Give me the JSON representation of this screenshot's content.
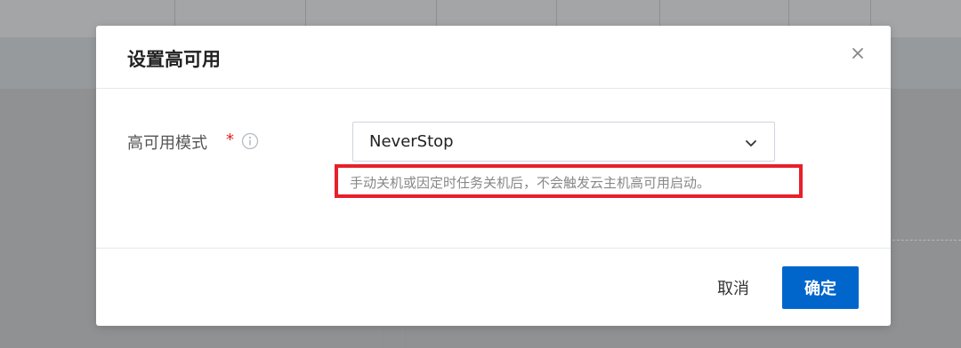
{
  "dialog": {
    "title": "设置高可用",
    "close_icon": "close-icon"
  },
  "form": {
    "label": "高可用模式",
    "required_mark": "*",
    "info_icon": "info-circle-icon",
    "select": {
      "value": "NeverStop",
      "arrow_icon": "chevron-down-icon"
    },
    "hint": "手动关机或因定时任务关机后，不会触发云主机高可用启动。"
  },
  "footer": {
    "cancel_label": "取消",
    "confirm_label": "确定"
  },
  "colors": {
    "primary": "#0066cc",
    "highlight_border": "#e8202a",
    "required": "#e02020",
    "overlay": "#8f9193"
  }
}
